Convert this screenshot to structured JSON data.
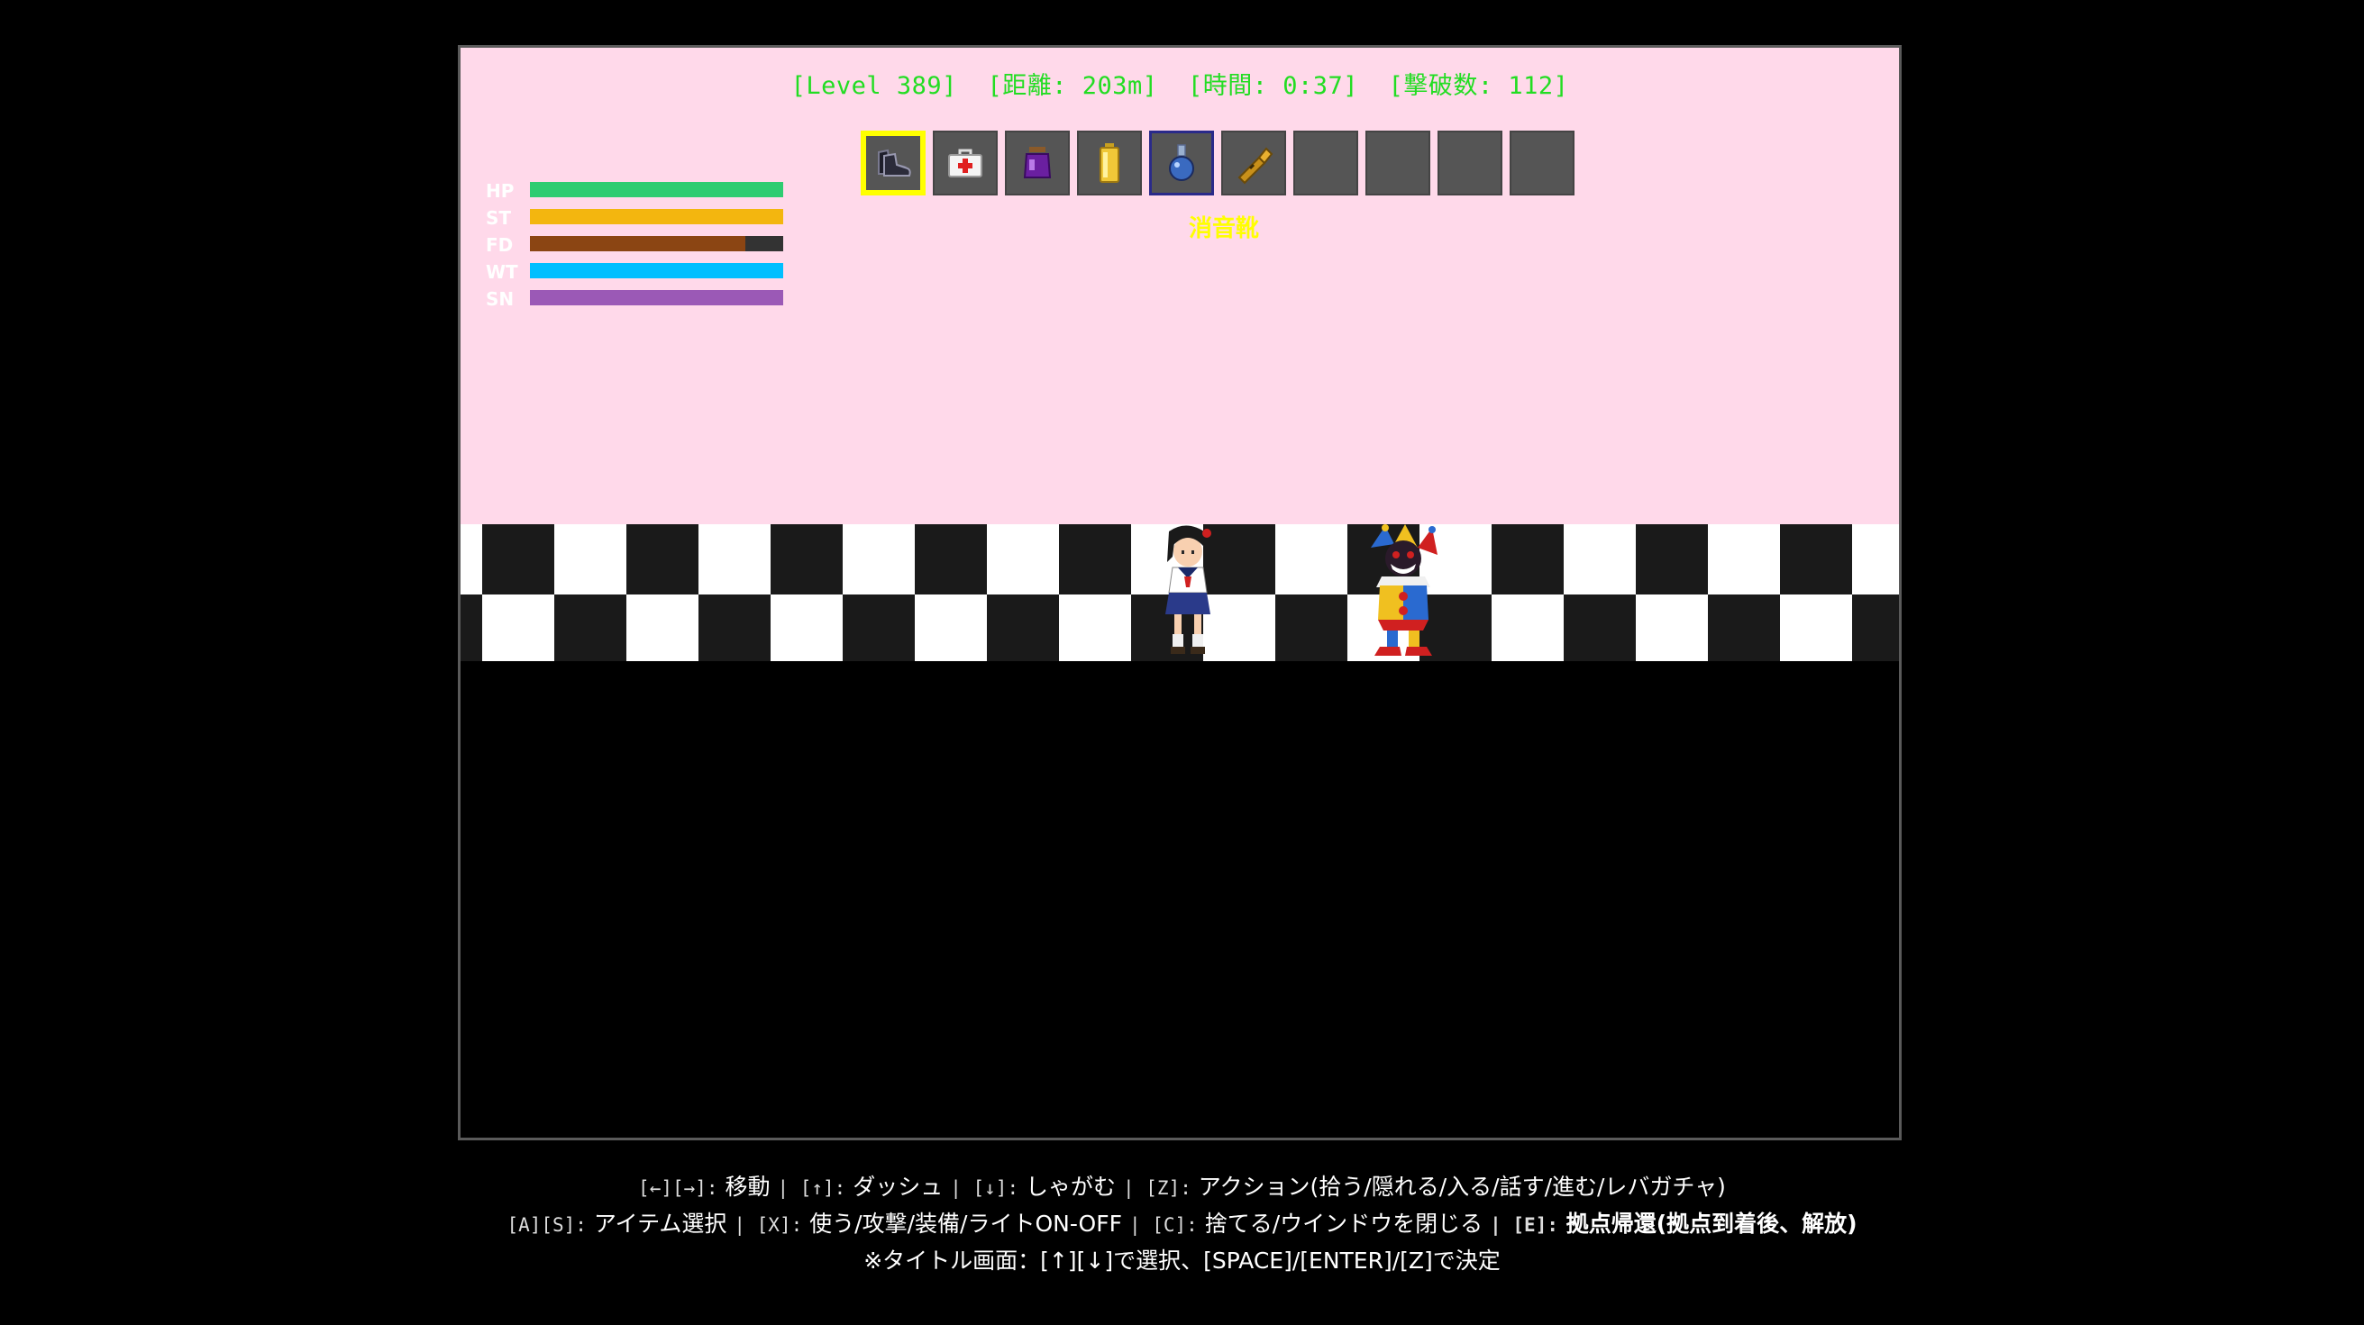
{
  "colors": {
    "sky": "#ffd9ea",
    "hud_text": "#22dd22",
    "selected": "#ffff00",
    "floor_dark": "#1a1a1a",
    "floor_light": "#ffffff"
  },
  "hud": {
    "level": "[Level 389]",
    "distance": "[距離: 203m]",
    "time": "[時間: 0:37]",
    "kills": "[撃破数: 112]"
  },
  "stats": [
    {
      "label": "HP",
      "fill": 1.0,
      "color": "#2ecc71"
    },
    {
      "label": "ST",
      "fill": 1.0,
      "color": "#f3b60f"
    },
    {
      "label": "FD",
      "fill": 0.85,
      "color": "#8b4513"
    },
    {
      "label": "WT",
      "fill": 1.0,
      "color": "#00bfff"
    },
    {
      "label": "SN",
      "fill": 1.0,
      "color": "#9b59b6"
    }
  ],
  "inventory": {
    "slots": [
      {
        "icon": "shoes-icon",
        "state": "selected"
      },
      {
        "icon": "first-aid-kit-icon",
        "state": "normal"
      },
      {
        "icon": "purple-potion-jar-icon",
        "state": "normal"
      },
      {
        "icon": "battery-icon",
        "state": "normal"
      },
      {
        "icon": "blue-flask-icon",
        "state": "equipped"
      },
      {
        "icon": "flashlight-icon",
        "state": "normal"
      },
      {
        "icon": "empty-slot",
        "state": "empty"
      },
      {
        "icon": "empty-slot",
        "state": "empty"
      },
      {
        "icon": "empty-slot",
        "state": "empty"
      },
      {
        "icon": "empty-slot",
        "state": "empty"
      }
    ],
    "selected_item_name": "消音靴"
  },
  "characters": [
    {
      "name": "schoolgirl-player-sprite"
    },
    {
      "name": "clown-enemy-sprite"
    }
  ],
  "controls": {
    "line1": [
      {
        "key": "[←][→]:",
        "desc": " 移動 "
      },
      {
        "key": "| [↑]:",
        "desc": " ダッシュ "
      },
      {
        "key": "| [↓]:",
        "desc": " しゃがむ "
      },
      {
        "key": "| [Z]:",
        "desc": " アクション(拾う/隠れる/入る/話す/進む/レバガチャ)"
      }
    ],
    "line2": [
      {
        "key": "[A][S]:",
        "desc": " アイテム選択 "
      },
      {
        "key": "| [X]:",
        "desc": " 使う/攻撃/装備/ライトON-OFF "
      },
      {
        "key": "| [C]:",
        "desc": " 捨てる/ウインドウを閉じる "
      },
      {
        "key": "| [E]:",
        "desc": " 拠点帰還(拠点到着後、解放)"
      }
    ],
    "line3": "※タイトル画面：[↑][↓]で選択、[SPACE]/[ENTER]/[Z]で決定"
  }
}
